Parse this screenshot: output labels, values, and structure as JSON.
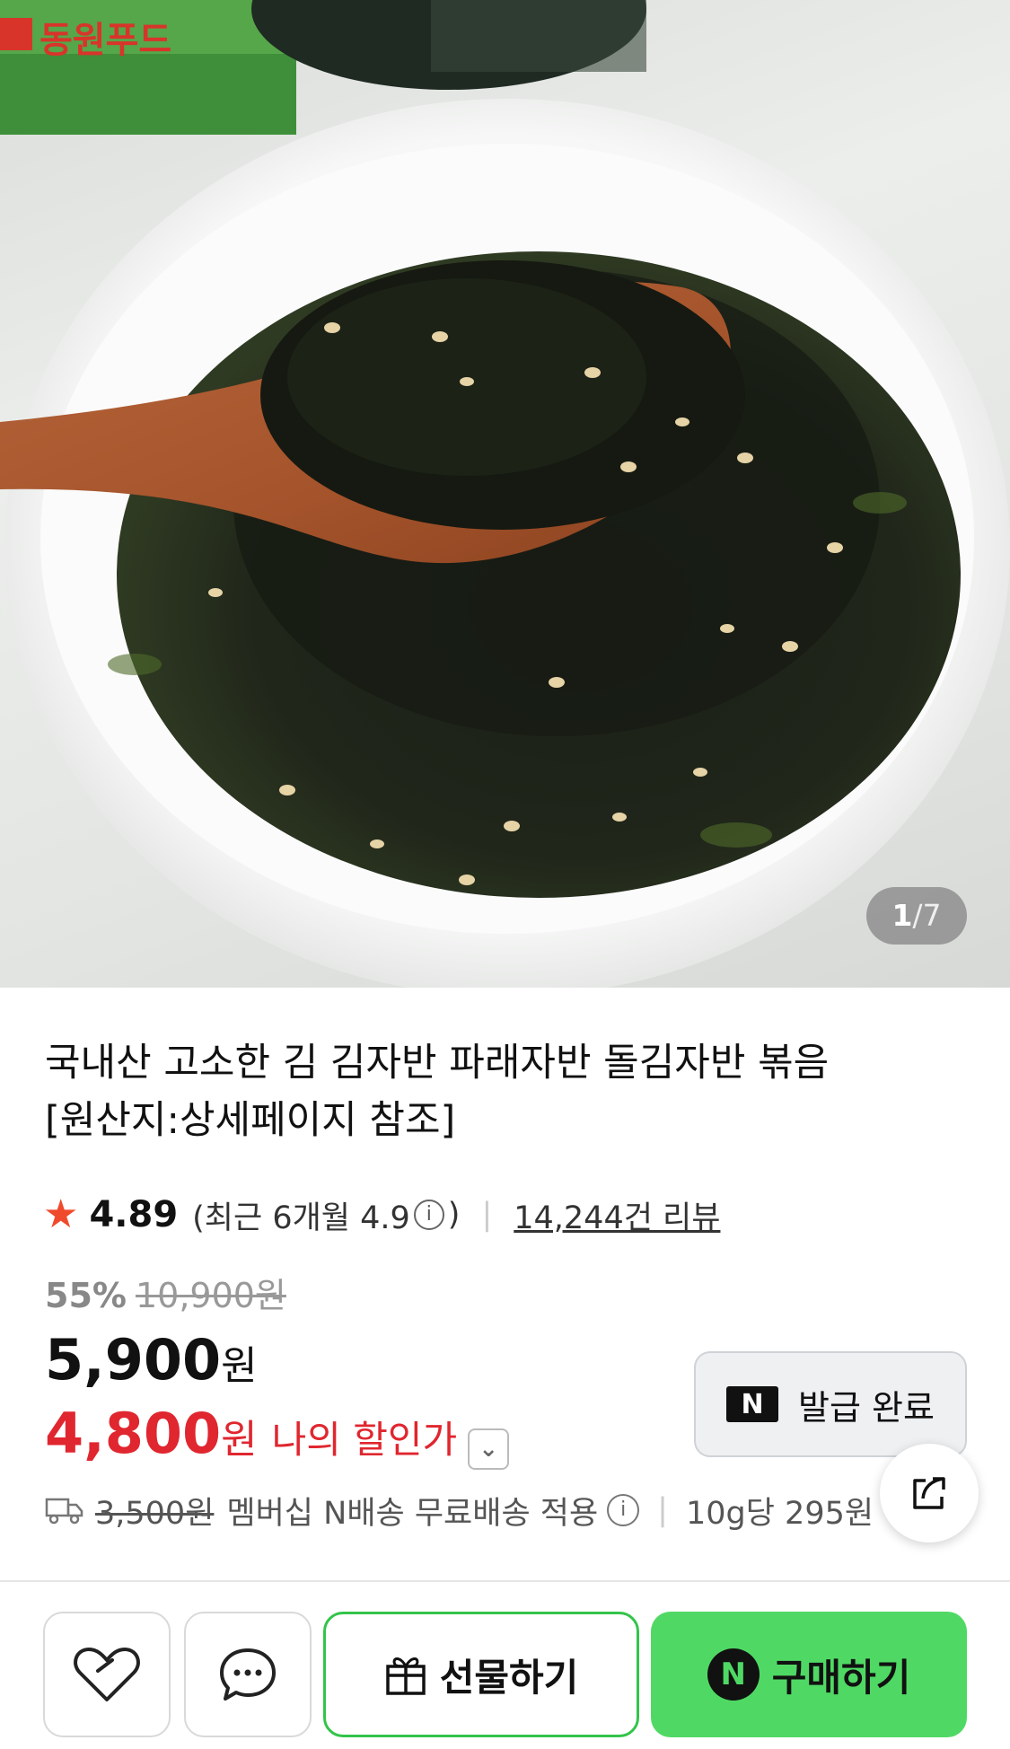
{
  "hero": {
    "pager_current": "1",
    "pager_separator": "/",
    "pager_total": "7",
    "logo_text": "동원푸드"
  },
  "product": {
    "title_line1": "국내산 고소한 김 김자반 파래자반 돌김자반 볶음",
    "title_line2": "[원산지:상세페이지 참조]"
  },
  "rating": {
    "star_icon": "star-icon",
    "score": "4.89",
    "recent_prefix": "(최근 6개월 4.9",
    "recent_suffix": ")",
    "info_glyph": "i",
    "separator": "|",
    "reviews": "14,244건 리뷰"
  },
  "price": {
    "discount_rate": "55%",
    "original": "10,900원",
    "sale_amount": "5,900",
    "currency": "원",
    "my_amount": "4,800",
    "my_label": "나의 할인가",
    "chevron": "⌄"
  },
  "coupon": {
    "badge": "N",
    "label": "발급 완료"
  },
  "delivery": {
    "fee_struck": "3,500원",
    "text": "멤버십 N배송 무료배송 적용",
    "info_glyph": "i",
    "separator": "|",
    "unit_price": "10g당 295원"
  },
  "actions": {
    "gift_label": "선물하기",
    "buy_badge": "N",
    "buy_label": "구매하기"
  },
  "colors": {
    "accent_red": "#e0262f",
    "star": "#f04a2c",
    "naver_green": "#4fd964"
  }
}
